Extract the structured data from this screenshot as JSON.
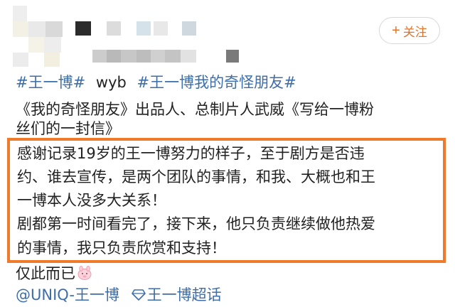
{
  "header": {
    "follow_label": "关注",
    "follow_plus": "+"
  },
  "post": {
    "tags": [
      "#王一博#",
      "wyb",
      "#王一博我的奇怪朋友#"
    ],
    "intro_lines": [
      "《我的奇怪朋友》出品人、总制片人武威《写给一博粉",
      "丝们的一封信》"
    ],
    "highlight_lines": [
      "感谢记录19岁的王一博努力的样子，至于剧方是否违",
      "约、谁去宣传，是两个团队的事情，和我、大概也和王",
      "一博本人没多大关系！",
      "剧都第一时间看完了，接下来，他只负责继续做他热爱",
      "的事情，我只负责欣赏和支持！"
    ],
    "closing": "仅此而已",
    "mention": "@UNIQ-王一博",
    "supertopic": "王一博超话"
  },
  "colors": {
    "link": "#3d6ea8",
    "accent": "#e0752a",
    "highlight_border": "#ef7a2b"
  }
}
